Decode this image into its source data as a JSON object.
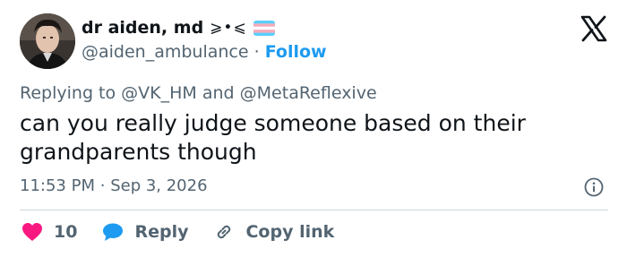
{
  "author": {
    "display_name": "dr aiden, md",
    "name_emoji": "⩾•⩽",
    "handle": "@aiden_ambulance",
    "separator": "·",
    "follow_label": "Follow"
  },
  "reply_context": {
    "prefix": "Replying to",
    "mention_1": "@VK_HM",
    "conjunction": "and",
    "mention_2": "@MetaReflexive"
  },
  "tweet": {
    "text": "can you really judge someone based on their grandparents though"
  },
  "meta": {
    "time": "11:53 PM",
    "separator": "·",
    "date": "Sep 3, 2026"
  },
  "actions": {
    "like_count": "10",
    "reply_label": "Reply",
    "copy_label": "Copy link"
  },
  "colors": {
    "accent": "#1d9bf0",
    "like": "#f91880",
    "text_secondary": "#536471",
    "flag_blue": "#5bcefa",
    "flag_pink": "#f5a9b8",
    "flag_white": "#ffffff"
  },
  "icons": {
    "brand": "x-logo-icon",
    "info": "info-icon",
    "like": "heart-icon",
    "reply": "speech-bubble-icon",
    "copy": "link-icon"
  }
}
